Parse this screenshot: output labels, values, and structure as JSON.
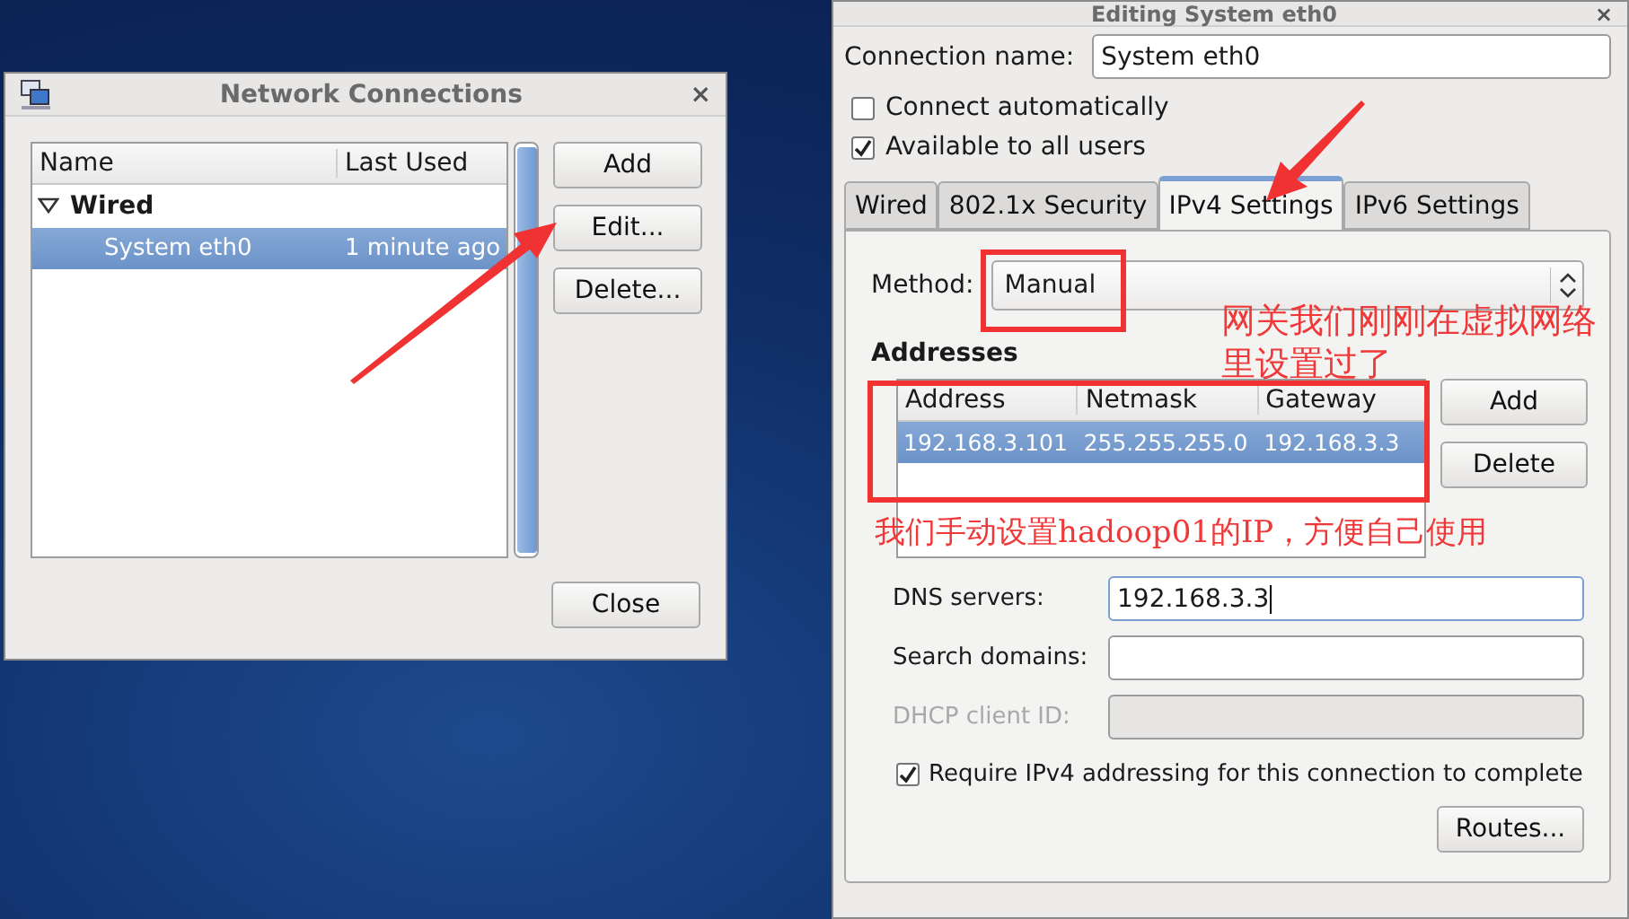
{
  "network_connections": {
    "title": "Network Connections",
    "close": "×",
    "columns": [
      "Name",
      "Last Used"
    ],
    "groups": [
      {
        "label": "Wired",
        "expanded": true,
        "children": [
          {
            "name": "System eth0",
            "last_used": "1 minute ago",
            "selected": true
          }
        ]
      }
    ],
    "buttons": [
      "Add",
      "Edit...",
      "Delete..."
    ],
    "close_button": "Close"
  },
  "editing_window": {
    "title": "Editing System eth0",
    "close": "×",
    "connection_name_label": "Connection name:",
    "connection_name": "System eth0",
    "options": [
      {
        "label": "Connect automatically",
        "checked": false
      },
      {
        "label": "Available to all users",
        "checked": true
      }
    ],
    "tabs": [
      {
        "label": "Wired",
        "selected": false
      },
      {
        "label": "802.1x Security",
        "selected": false
      },
      {
        "label": "IPv4 Settings",
        "selected": true
      },
      {
        "label": "IPv6 Settings",
        "selected": false
      }
    ],
    "method_label": "Method:",
    "method": "Manual",
    "addresses_heading": "Addresses",
    "address_columns": [
      "Address",
      "Netmask",
      "Gateway"
    ],
    "address_rows": [
      {
        "cells": [
          "192.168.3.101",
          "255.255.255.0",
          "192.168.3.3"
        ],
        "selected": true
      }
    ],
    "address_buttons": [
      "Add",
      "Delete"
    ],
    "fields": [
      {
        "label": "DNS servers:",
        "value": "192.168.3.3",
        "disabled": false,
        "focused": true
      },
      {
        "label": "Search domains:",
        "disabled": false,
        "focused": false
      },
      {
        "label": "DHCP client ID:",
        "disabled": true,
        "focused": false
      }
    ],
    "require": {
      "label": "Require IPv4 addressing for this connection to complete",
      "checked": true
    },
    "routes_button": "Routes..."
  },
  "annotations": [
    {
      "kind": "note",
      "text": "网关我们刚刚在虚拟网络里设置过了"
    },
    {
      "kind": "note",
      "text": "我们手动设置hadoop01的IP，方便自己使用"
    }
  ]
}
